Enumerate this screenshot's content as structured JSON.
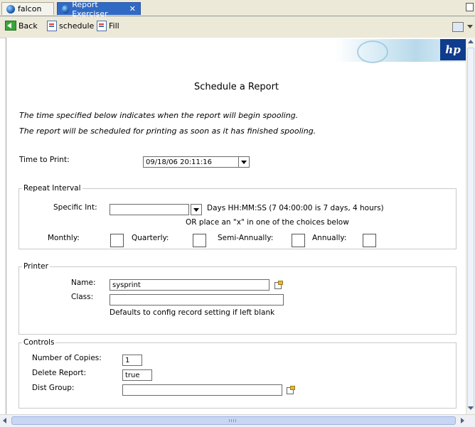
{
  "tabs": [
    {
      "label": "falcon",
      "icon": "globe-icon"
    },
    {
      "label": "Report Exerciser",
      "icon": "globe-icon",
      "close": "✕"
    }
  ],
  "toolbar": {
    "back_label": "Back",
    "schedule_label": "schedule",
    "fill_label": "Fill"
  },
  "brand": {
    "logo_text": "hp",
    "color": "#0f3c8c"
  },
  "page": {
    "title": "Schedule a Report",
    "note1": "The time specified below indicates when the report will begin spooling.",
    "note2": "The report will be scheduled for printing as soon as it has finished spooling."
  },
  "time_to_print": {
    "label": "Time to Print:",
    "value": "09/18/06 20:11:16"
  },
  "repeat_interval": {
    "legend": "Repeat Interval",
    "specific_label": "Specific Int:",
    "specific_value": "",
    "hint": "Days HH:MM:SS (7 04:00:00 is 7 days, 4 hours)",
    "or_text": "OR place an \"x\" in one of the choices below",
    "monthly_label": "Monthly:",
    "quarterly_label": "Quarterly:",
    "semiannually_label": "Semi-Annually:",
    "annually_label": "Annually:"
  },
  "printer": {
    "legend": "Printer",
    "name_label": "Name:",
    "name_value": "sysprint",
    "class_label": "Class:",
    "class_value": "",
    "class_note": "Defaults to config record setting if left blank"
  },
  "controls": {
    "legend": "Controls",
    "copies_label": "Number of Copies:",
    "copies_value": "1",
    "delete_label": "Delete Report:",
    "delete_value": "true",
    "dist_label": "Dist Group:",
    "dist_value": ""
  }
}
